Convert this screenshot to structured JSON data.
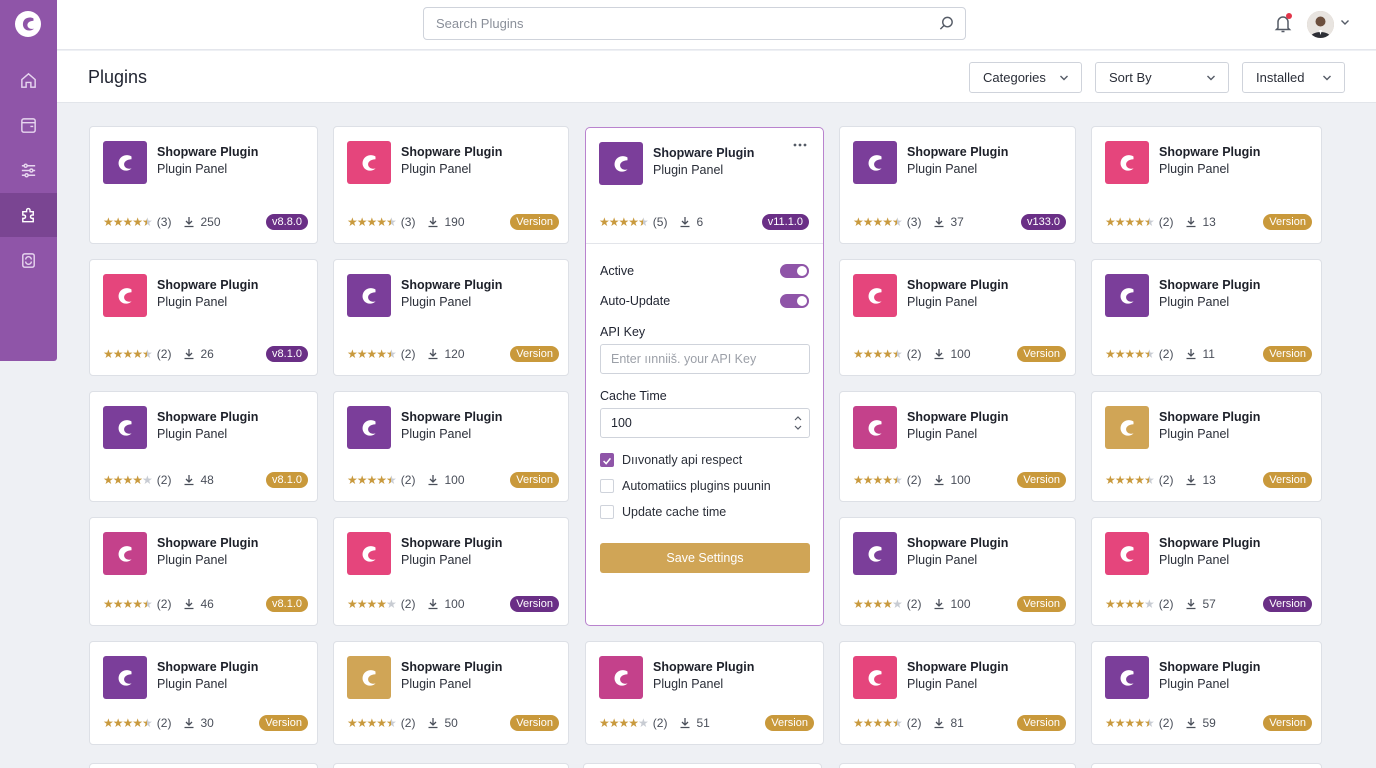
{
  "topbar": {
    "search_placeholder": "Search Plugins"
  },
  "header": {
    "title": "Plugins",
    "categories_label": "Categories",
    "sort_label": "Sort By",
    "installed_label": "Installed"
  },
  "sidebar": {
    "items": [
      "home-icon",
      "wallet-icon",
      "sliders-icon",
      "puzzle-icon",
      "refresh-icon"
    ],
    "accent": "#8f55a8"
  },
  "card_title": "Shopware Plugin",
  "card_subtitle": "Plugin Panel",
  "cards": [
    {
      "color": "purple",
      "rating": 4.5,
      "reviews": "(3)",
      "downloads": "250",
      "badge": "v8.8.0",
      "badge_style": "purple"
    },
    {
      "color": "pink",
      "rating": 4.5,
      "reviews": "(3)",
      "downloads": "190",
      "badge": "Version",
      "badge_style": "gold"
    },
    {
      "color": "purple",
      "rating": 4.5,
      "reviews": "(5)",
      "downloads": "6",
      "badge": "v11.1.0",
      "badge_style": "purple",
      "expanded": true
    },
    {
      "color": "purple",
      "rating": 4.5,
      "reviews": "(3)",
      "downloads": "37",
      "badge": "v133.0",
      "badge_style": "purple"
    },
    {
      "color": "pink",
      "rating": 4.5,
      "reviews": "(2)",
      "downloads": "13",
      "badge": "Version",
      "badge_style": "gold"
    },
    {
      "color": "pink",
      "rating": 4.5,
      "reviews": "(2)",
      "downloads": "26",
      "badge": "v8.1.0",
      "badge_style": "purple"
    },
    {
      "color": "purple",
      "rating": 4.5,
      "reviews": "(2)",
      "downloads": "120",
      "badge": "Version",
      "badge_style": "gold"
    },
    {
      "color": "pink",
      "rating": 4.5,
      "reviews": "(2)",
      "downloads": "100",
      "badge": "Version",
      "badge_style": "gold"
    },
    {
      "color": "purple",
      "rating": 4.5,
      "reviews": "(2)",
      "downloads": "11",
      "badge": "Version",
      "badge_style": "gold"
    },
    {
      "color": "purple",
      "rating": 4,
      "reviews": "(2)",
      "downloads": "48",
      "badge": "v8.1.0",
      "badge_style": "gold"
    },
    {
      "color": "purple",
      "rating": 4.5,
      "reviews": "(2)",
      "downloads": "100",
      "badge": "Version",
      "badge_style": "gold"
    },
    {
      "color": "magenta",
      "rating": 4.5,
      "reviews": "(2)",
      "downloads": "100",
      "badge": "Version",
      "badge_style": "gold"
    },
    {
      "color": "gold",
      "rating": 4.5,
      "reviews": "(2)",
      "downloads": "13",
      "badge": "Version",
      "badge_style": "gold"
    },
    {
      "color": "magenta",
      "rating": 4.5,
      "reviews": "(2)",
      "downloads": "46",
      "badge": "v8.1.0",
      "badge_style": "gold"
    },
    {
      "color": "pink",
      "rating": 4,
      "reviews": "(2)",
      "downloads": "100",
      "badge": "Version",
      "badge_style": "purple"
    },
    {
      "color": "purple",
      "rating": 4,
      "reviews": "(2)",
      "downloads": "100",
      "badge": "Version",
      "badge_style": "gold"
    },
    {
      "color": "pink",
      "rating": 4,
      "reviews": "(2)",
      "downloads": "57",
      "badge": "Version",
      "badge_style": "purple",
      "subtitle": "Plugln Panel"
    },
    {
      "color": "purple",
      "rating": 4.5,
      "reviews": "(2)",
      "downloads": "30",
      "badge": "Version",
      "badge_style": "gold"
    },
    {
      "color": "gold",
      "rating": 4.5,
      "reviews": "(2)",
      "downloads": "50",
      "badge": "Version",
      "badge_style": "gold"
    },
    {
      "color": "magenta",
      "rating": 4,
      "reviews": "(2)",
      "downloads": "51",
      "badge": "Version",
      "badge_style": "gold",
      "subtitle": "Plugln Panel"
    },
    {
      "color": "pink",
      "rating": 4.5,
      "reviews": "(2)",
      "downloads": "81",
      "badge": "Version",
      "badge_style": "gold"
    },
    {
      "color": "purple",
      "rating": 4.5,
      "reviews": "(2)",
      "downloads": "59",
      "badge": "Version",
      "badge_style": "gold"
    }
  ],
  "expanded": {
    "active_label": "Active",
    "active_on": true,
    "auto_update_label": "Auto-Update",
    "auto_update_on": true,
    "api_key_label": "API Key",
    "api_key_placeholder": "Enter ıınniiš. your API Key",
    "cache_time_label": "Cache Time",
    "cache_time_value": "100",
    "checkboxes": [
      {
        "label": "Dııvonatly api respect",
        "checked": true
      },
      {
        "label": "Automatiics plugins puunin",
        "checked": false
      },
      {
        "label": "Update cache time",
        "checked": false
      }
    ],
    "save_label": "Save Settings"
  },
  "colors": {
    "purple": "#7b3e9a",
    "pink": "#e5457c",
    "magenta": "#c4418b",
    "gold": "#d0a556",
    "badge_gold": "#c9993b",
    "badge_purple": "#6a2f86"
  }
}
